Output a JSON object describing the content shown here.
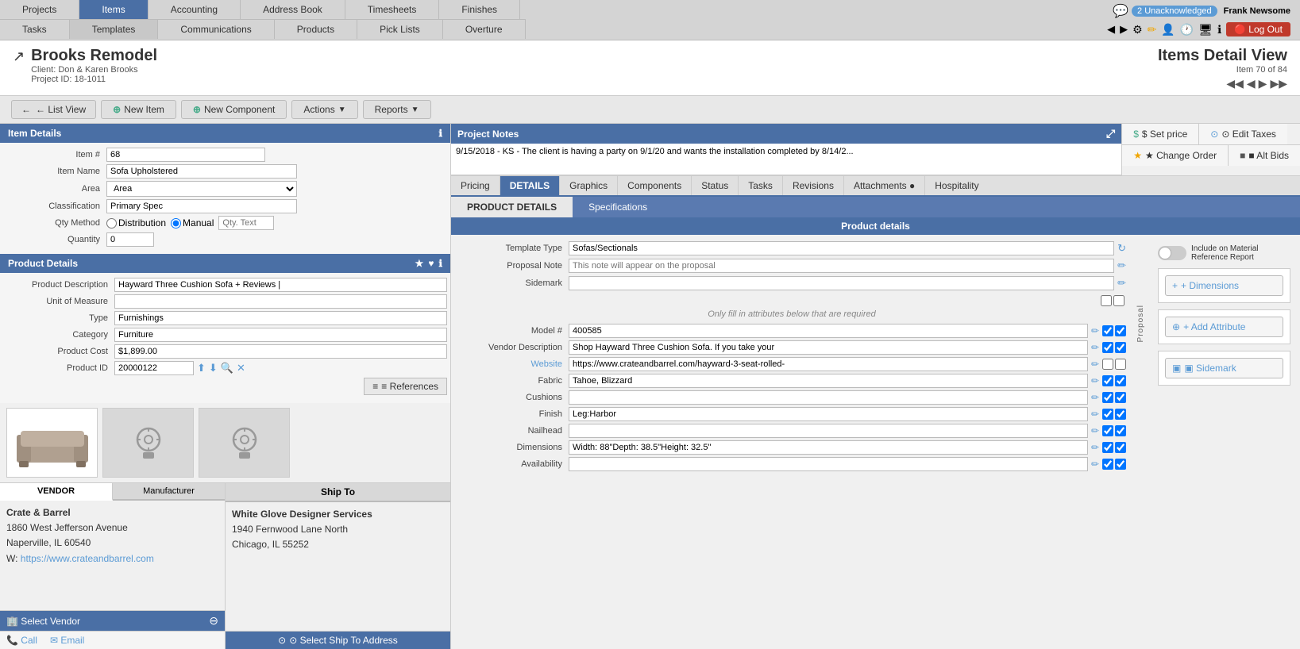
{
  "nav": {
    "row1": [
      "Projects",
      "Items",
      "Accounting",
      "Address Book",
      "Timesheets",
      "Finishes"
    ],
    "row2": [
      "Tasks",
      "Templates",
      "Communications",
      "Products",
      "Pick Lists",
      "Overture"
    ],
    "active_row1": "Items",
    "active_row2": "Templates"
  },
  "topright": {
    "notifications": "2 Unacknowledged",
    "username": "Frank Newsome",
    "logout": "Log Out"
  },
  "header": {
    "project_name": "Brooks Remodel",
    "client": "Client: Don & Karen Brooks",
    "project_id": "Project ID: 18-1011",
    "page_title": "Items Detail View",
    "item_count": "Item 70 of 84",
    "external_link": "↗"
  },
  "toolbar": {
    "list_view": "← List View",
    "new_item": "⊕ New Item",
    "new_component": "⊕ New Component",
    "actions": "Actions",
    "reports": "Reports"
  },
  "item_details": {
    "title": "Item Details",
    "item_number_label": "Item #",
    "item_number": "68",
    "item_name_label": "Item Name",
    "item_name": "Sofa Upholstered",
    "area_label": "Area",
    "area": "Area",
    "classification_label": "Classification",
    "classification": "Primary Spec",
    "qty_method_label": "Qty Method",
    "qty_method_distribution": "Distribution",
    "qty_method_manual": "Manual",
    "qty_text": "Qty. Text",
    "quantity_label": "Quantity",
    "quantity": "0"
  },
  "product_details": {
    "title": "Product Details",
    "product_desc_label": "Product Description",
    "product_desc": "Hayward Three Cushion Sofa + Reviews |",
    "unit_of_measure_label": "Unit of Measure",
    "unit_of_measure": "",
    "type_label": "Type",
    "type": "Furnishings",
    "category_label": "Category",
    "category": "Furniture",
    "product_cost_label": "Product Cost",
    "product_cost": "$1,899.00",
    "product_id_label": "Product ID",
    "product_id": "20000122",
    "references": "≡ References"
  },
  "project_notes": {
    "title": "Project Notes",
    "note": "9/15/2018 - KS - The client is having a party on 9/1/20 and wants the installation completed by 8/14/2..."
  },
  "right_actions": {
    "set_price": "$ Set price",
    "edit_taxes": "⊙ Edit Taxes",
    "change_order": "★ Change Order",
    "alt_bids": "■ Alt Bids"
  },
  "detail_tabs": {
    "tabs": [
      "Pricing",
      "DETAILS",
      "Graphics",
      "Components",
      "Status",
      "Tasks",
      "Revisions",
      "Attachments ●",
      "Hospitality"
    ],
    "active": "DETAILS"
  },
  "product_detail_content": {
    "tab_product": "PRODUCT DETAILS",
    "tab_specifications": "Specifications",
    "subheader": "Product details",
    "template_type_label": "Template Type",
    "template_type": "Sofas/Sectionals",
    "proposal_note_label": "Proposal Note",
    "proposal_note_placeholder": "This note will appear on the proposal",
    "sidemark_label": "Sidemark",
    "sidemark": "",
    "only_fill_notice": "Only fill in attributes below that are required",
    "model_label": "Model #",
    "model": "400585",
    "vendor_desc_label": "Vendor Description",
    "vendor_desc": "Shop Hayward Three Cushion Sofa. If you take your",
    "website_label": "Website",
    "website": "https://www.crateandbarrel.com/hayward-3-seat-rolled-",
    "fabric_label": "Fabric",
    "fabric": "Tahoe, Blizzard",
    "cushions_label": "Cushions",
    "cushions": "",
    "finish_label": "Finish",
    "finish": "Leg:Harbor",
    "nailhead_label": "Nailhead",
    "nailhead": "",
    "dimensions_label": "Dimensions",
    "dimensions": "Width: 88\"Depth: 38.5\"Height: 32.5\"",
    "availability_label": "Availability",
    "availability": ""
  },
  "right_side_panel": {
    "include_report_label": "Include on Material Reference Report",
    "dimensions_btn": "+ Dimensions",
    "add_attr_btn": "+ Add Attribute",
    "sidemark_btn": "▣ Sidemark"
  },
  "vendor": {
    "tab_vendor": "VENDOR",
    "tab_manufacturer": "Manufacturer",
    "name": "Crate & Barrel",
    "address": "1860 West Jefferson Avenue",
    "city_state": "Naperville, IL 60540",
    "website_label": "W:",
    "website": "https://www.crateandbarrel.com",
    "select_vendor_btn": "🏢 Select Vendor",
    "call_label": "📞 Call",
    "email_label": "✉ Email"
  },
  "ship_to": {
    "title": "Ship To",
    "name": "White Glove Designer Services",
    "address": "1940 Fernwood Lane North",
    "city_state": "Chicago, IL 55252",
    "select_btn": "⊙ Select Ship To Address"
  }
}
